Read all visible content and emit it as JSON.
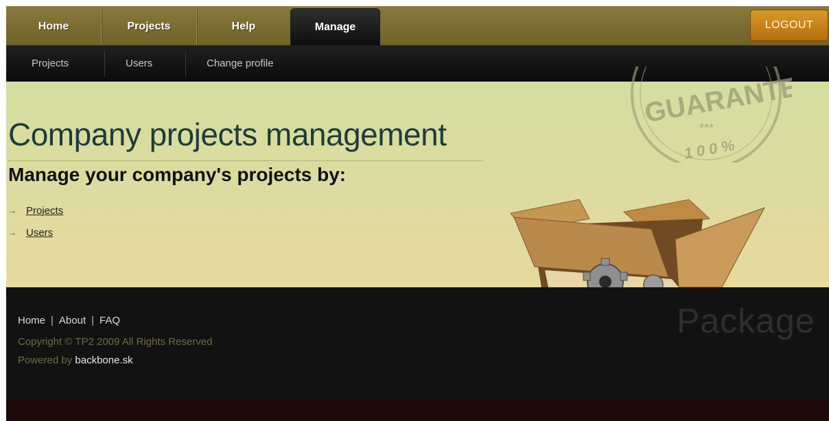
{
  "nav": {
    "tabs": [
      {
        "label": "Home"
      },
      {
        "label": "Projects"
      },
      {
        "label": "Help"
      },
      {
        "label": "Manage",
        "active": true
      }
    ],
    "logout_label": "LOGOUT"
  },
  "subnav": {
    "items": [
      {
        "label": "Projects"
      },
      {
        "label": "Users"
      },
      {
        "label": "Change profile"
      }
    ]
  },
  "hero": {
    "title": "Company projects management",
    "subtitle": "Manage your company's projects by:",
    "links": [
      {
        "label": "Projects"
      },
      {
        "label": "Users"
      }
    ],
    "stamp": {
      "line1": "GUARANTEE",
      "stars": "***",
      "line2": "100%"
    }
  },
  "footer": {
    "links": [
      "Home",
      "About",
      "FAQ"
    ],
    "copyright": "Copyright © TP2 2009 All Rights Reserved",
    "powered_prefix": "Powered by ",
    "powered_link": "backbone.sk",
    "watermark": "Package"
  },
  "colors": {
    "nav_bg": "#7d6e33",
    "logout_bg": "#c9820f",
    "hero_bg": "#dcdba0",
    "footer_bg": "#121212"
  },
  "icons": [
    "arrow-bullet-icon",
    "guarantee-stamp-icon",
    "cardboard-box-icon",
    "gear-icon"
  ]
}
